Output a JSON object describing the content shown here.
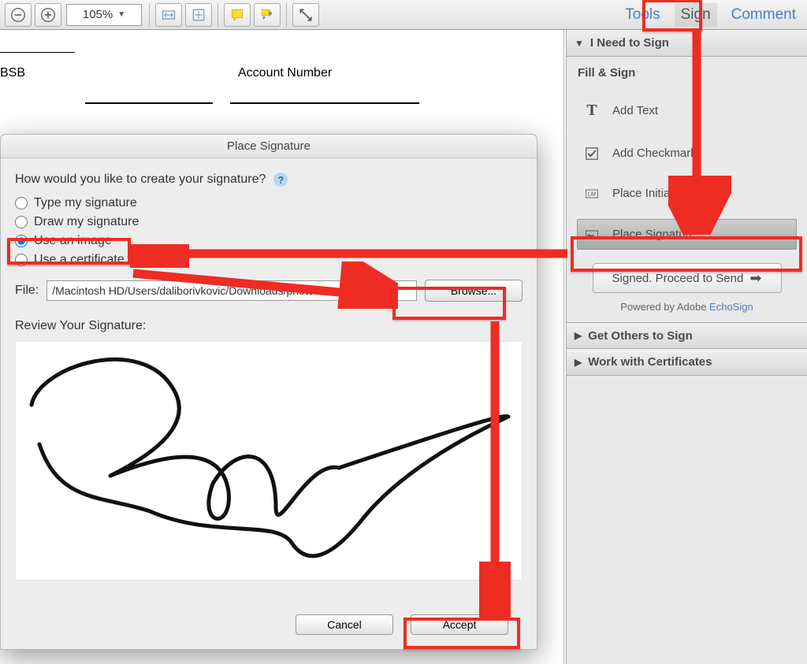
{
  "toolbar": {
    "zoom_value": "105%",
    "menu": {
      "tools": "Tools",
      "sign": "Sign",
      "comment": "Comment"
    }
  },
  "document": {
    "field1_label": "BSB",
    "field2_label": "Account Number"
  },
  "panel": {
    "header1": "I Need to Sign",
    "section1_title": "Fill & Sign",
    "items": [
      {
        "label": "Add Text",
        "icon": "text-icon"
      },
      {
        "label": "Add Checkmark",
        "icon": "checkmark-icon"
      },
      {
        "label": "Place Initials",
        "icon": "initials-icon"
      },
      {
        "label": "Place Signature",
        "icon": "signature-icon"
      }
    ],
    "proceed_btn": "Signed. Proceed to Send",
    "powered_prefix": "Powered by Adobe ",
    "powered_link": "EchoSign",
    "header2": "Get Others to Sign",
    "header3": "Work with Certificates"
  },
  "dialog": {
    "title": "Place Signature",
    "question": "How would you like to create your signature?",
    "options": {
      "type": "Type my signature",
      "draw": "Draw my signature",
      "image": "Use an image",
      "cert": "Use a certificate"
    },
    "file_label": "File:",
    "file_value": "/Macintosh HD/Users/daliborivkovic/Downloads/photo.",
    "browse_btn": "Browse...",
    "review_label": "Review Your Signature:",
    "cancel_btn": "Cancel",
    "accept_btn": "Accept"
  }
}
